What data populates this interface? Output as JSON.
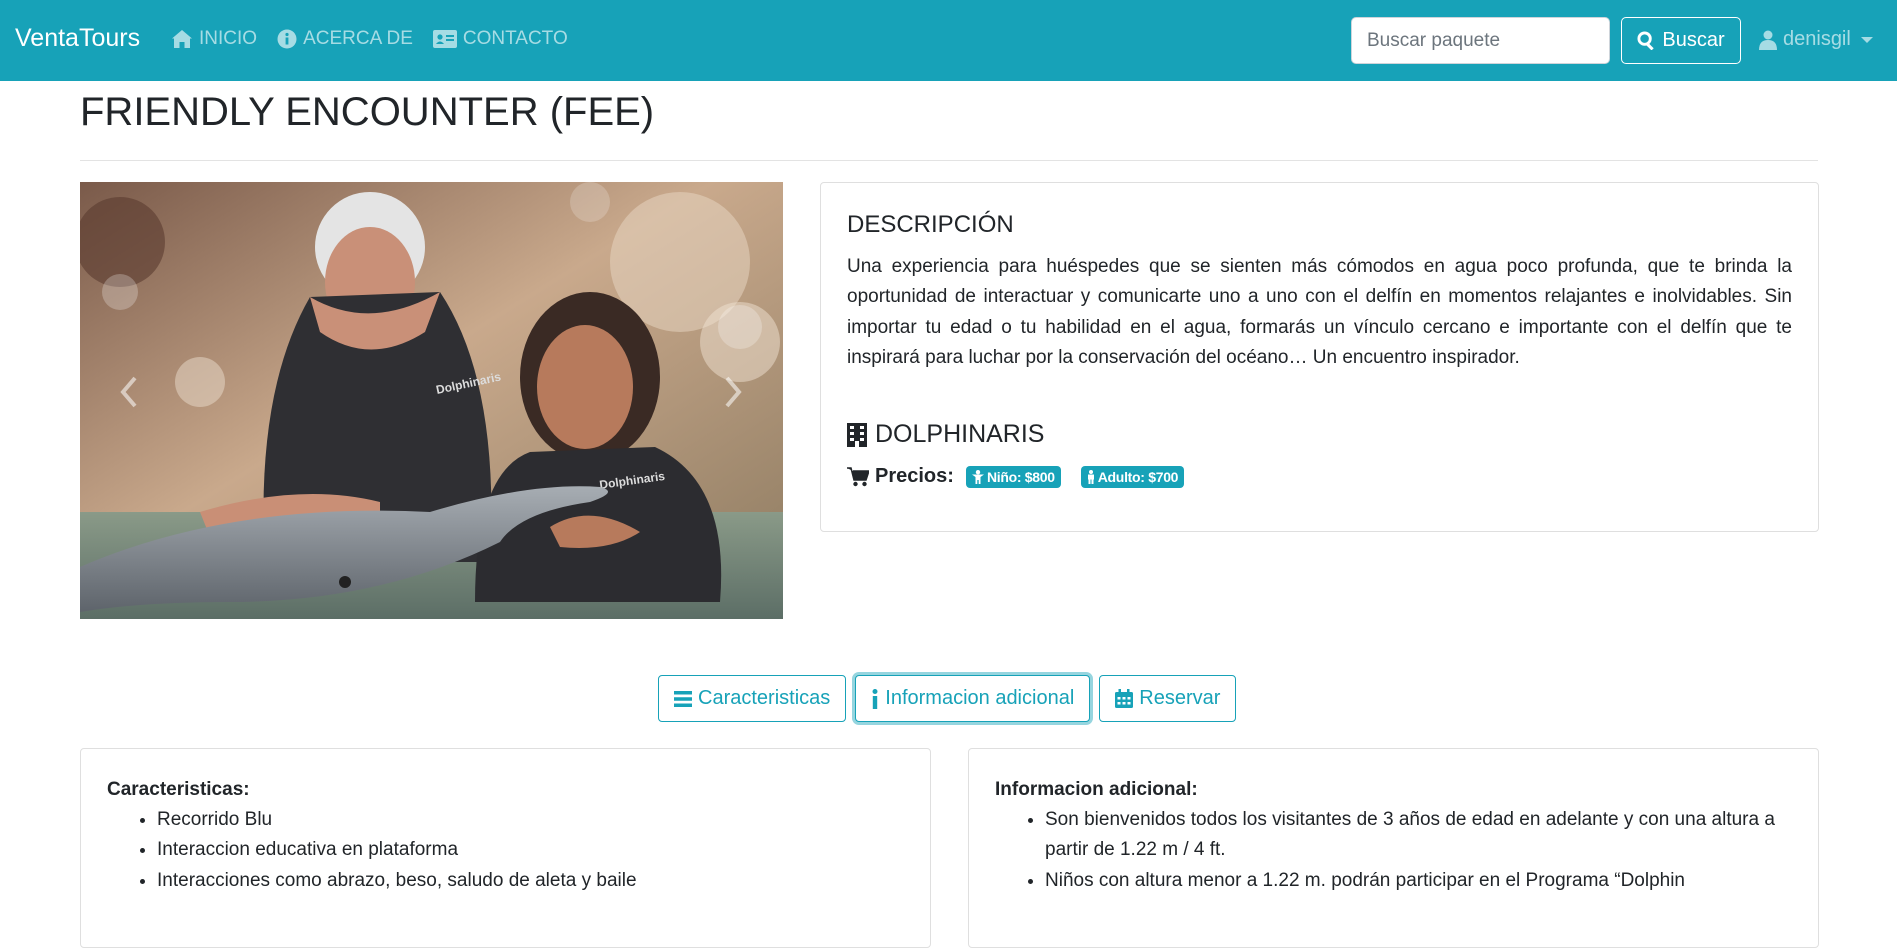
{
  "navbar": {
    "brand": "VentaTours",
    "links": [
      {
        "label": "INICIO",
        "icon": "home-icon"
      },
      {
        "label": "ACERCA DE",
        "icon": "info-circle-icon"
      },
      {
        "label": "CONTACTO",
        "icon": "id-card-icon"
      }
    ],
    "search_placeholder": "Buscar paquete",
    "search_button": "Buscar",
    "user": "denisgil"
  },
  "page": {
    "title": "FRIENDLY ENCOUNTER (FEE)"
  },
  "carousel": {
    "image_icon": "dolphin-encounter-photo",
    "vest_text": "Dolphinaris"
  },
  "description": {
    "heading": "DESCRIPCIÓN",
    "text": "Una experiencia para huéspedes que se sienten más cómodos en agua poco profunda, que te brinda la oportunidad de interactuar y comunicarte uno a uno con el delfín en momentos relajantes e inolvidables. Sin importar tu edad o tu habilidad en el agua, formarás un vínculo cercano e importante con el delfín que te inspirará para luchar por la conservación del océano… Un encuentro inspirador.",
    "provider": "DOLPHINARIS",
    "prices_label": "Precios:",
    "price_child": "Niño: $800",
    "price_adult": "Adulto: $700"
  },
  "actions": {
    "features": "Caracteristicas",
    "additional_info": "Informacion adicional",
    "reserve": "Reservar"
  },
  "features_panel": {
    "title": "Caracteristicas:",
    "items": [
      "Recorrido Blu",
      "Interaccion educativa en plataforma",
      "Interacciones como abrazo, beso, saludo de aleta y baile"
    ]
  },
  "info_panel": {
    "title": "Informacion adicional:",
    "items": [
      "Son bienvenidos todos los visitantes de 3 años de edad en adelante y con una altura a partir de 1.22 m / 4 ft.",
      "Niños con altura menor a 1.22 m. podrán participar en el Programa “Dolphin"
    ]
  },
  "colors": {
    "primary": "#17a2b8",
    "text": "#212529"
  }
}
